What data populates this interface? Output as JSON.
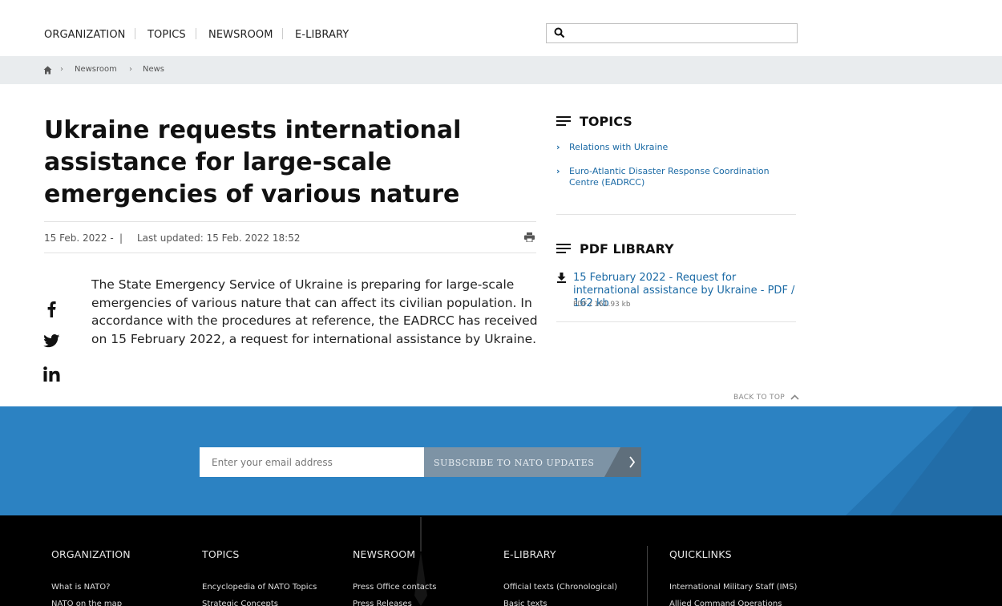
{
  "nav": {
    "items": [
      "ORGANIZATION",
      "TOPICS",
      "NEWSROOM",
      "E-LIBRARY"
    ],
    "search_placeholder": ""
  },
  "breadcrumb": {
    "items": [
      "Newsroom",
      "News"
    ]
  },
  "article": {
    "title": "Ukraine requests international assistance for large-scale emergencies of various nature",
    "date": "15 Feb. 2022 -",
    "separator": "|",
    "last_updated": "Last updated: 15 Feb. 2022 18:52",
    "body": "The State Emergency Service of Ukraine is preparing for large-scale emergencies of various nature that can affect its civilian population. In accordance with the procedures at reference, the EADRCC has received on 15 February 2022, a request for international assistance by Ukraine."
  },
  "sidebar": {
    "topics_heading": "TOPICS",
    "topics": [
      "Relations with Ukraine",
      "Euro-Atlantic Disaster Response Coordination Centre (EADRCC)"
    ],
    "pdf_heading": "PDF LIBRARY",
    "pdf_link": "15 February 2022 - Request for international assistance by Ukraine - PDF / 162 kb",
    "pdf_meta": "PDF / 161.93 kb"
  },
  "back_to_top": "BACK TO TOP",
  "subscribe": {
    "email_placeholder": "Enter your email address",
    "button_label": "SUBSCRIBE TO NATO UPDATES"
  },
  "footer": {
    "columns": [
      {
        "heading": "ORGANIZATION",
        "links": [
          "What is NATO?",
          "NATO on the map"
        ]
      },
      {
        "heading": "TOPICS",
        "links": [
          "Encyclopedia of NATO Topics",
          "Strategic Concepts"
        ]
      },
      {
        "heading": "NEWSROOM",
        "links": [
          "Press Office contacts",
          "Press Releases"
        ]
      },
      {
        "heading": "E-LIBRARY",
        "links": [
          "Official texts (Chronological)",
          "Basic texts"
        ]
      },
      {
        "heading": "QUICKLINKS",
        "links": [
          "International Military Staff (IMS)",
          "Allied Command Operations"
        ]
      }
    ]
  },
  "colors": {
    "link": "#1b6aa5",
    "band_blue": "#2c82c2",
    "button_grey": "#7d93a5",
    "footer_bg": "#000000"
  },
  "icons": [
    "home-icon",
    "search-icon",
    "print-icon",
    "facebook-icon",
    "twitter-icon",
    "linkedin-icon",
    "download-icon",
    "chevron-up-icon",
    "chevron-right-icon",
    "hamburger-icon"
  ]
}
